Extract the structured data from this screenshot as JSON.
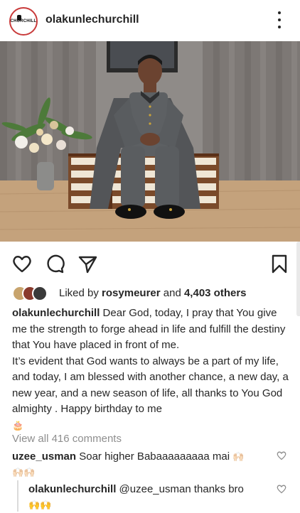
{
  "post": {
    "username": "olakunlechurchill",
    "avatar_logo_text": "CHURCHILL"
  },
  "likes": {
    "prefix": "Liked by",
    "user": "rosymeurer",
    "conjunction": "and",
    "others": "4,403 others"
  },
  "caption": {
    "username": "olakunlechurchill",
    "paragraph1": "Dear God, today, I pray that You give me the strength to forge ahead in life and fulfill the destiny that You have placed in front of me.",
    "paragraph2": "It’s evident that God wants to always be a part of my life, and today, I am blessed with another chance, a new day, a new year, and a new season of life, all thanks to You God almighty . Happy birthday to me",
    "emoji": "🎂"
  },
  "view_all_comments": "View all 416 comments",
  "comments": [
    {
      "username": "uzee_usman",
      "text": "Soar higher Babaaaaaaaaa mai",
      "emoji": "🙌🏻",
      "emoji_line2": "🙌🏻🙌🏻"
    },
    {
      "username": "olakunlechurchill",
      "mention": "@uzee_usman",
      "text": "thanks bro",
      "emoji": "🙌🙌"
    }
  ],
  "icons": {
    "more": "more-vertical-icon",
    "like": "heart-icon",
    "comment": "comment-icon",
    "share": "paper-plane-icon",
    "save": "bookmark-icon"
  },
  "colors": {
    "text": "#262626",
    "muted": "#8e8e8e",
    "avatar_ring": "#c93b3b"
  }
}
